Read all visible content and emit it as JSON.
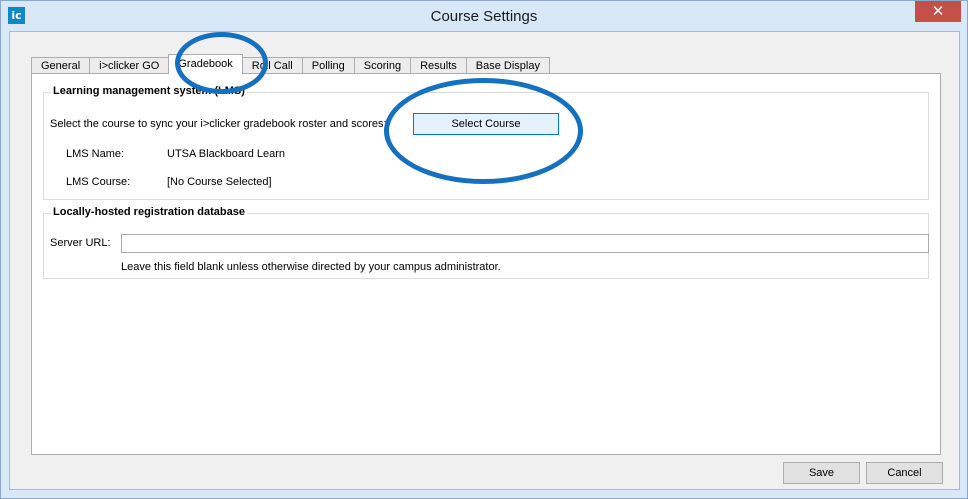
{
  "window": {
    "title": "Course Settings",
    "logo_text": "ic",
    "close_glyph": "✕"
  },
  "tabs": [
    {
      "label": "General",
      "active": false
    },
    {
      "label": "i>clicker GO",
      "active": false
    },
    {
      "label": "Gradebook",
      "active": true
    },
    {
      "label": "Roll Call",
      "active": false
    },
    {
      "label": "Polling",
      "active": false
    },
    {
      "label": "Scoring",
      "active": false
    },
    {
      "label": "Results",
      "active": false
    },
    {
      "label": "Base Display",
      "active": false
    }
  ],
  "lms": {
    "group_title": "Learning management system (LMS)",
    "instruction": "Select the course to sync your i>clicker gradebook roster and scores:",
    "select_course_label": "Select Course",
    "name_label": "LMS Name:",
    "name_value": "UTSA Blackboard Learn",
    "course_label": "LMS Course:",
    "course_value": "[No Course Selected]"
  },
  "registration": {
    "group_title": "Locally-hosted registration database",
    "server_url_label": "Server URL:",
    "server_url_value": "",
    "hint": "Leave this field blank unless otherwise directed by your campus administrator."
  },
  "footer": {
    "save_label": "Save",
    "cancel_label": "Cancel"
  },
  "colors": {
    "highlight_ring": "#1570c0",
    "close_button": "#c74f4a",
    "title_bar": "#d9e8f6"
  }
}
